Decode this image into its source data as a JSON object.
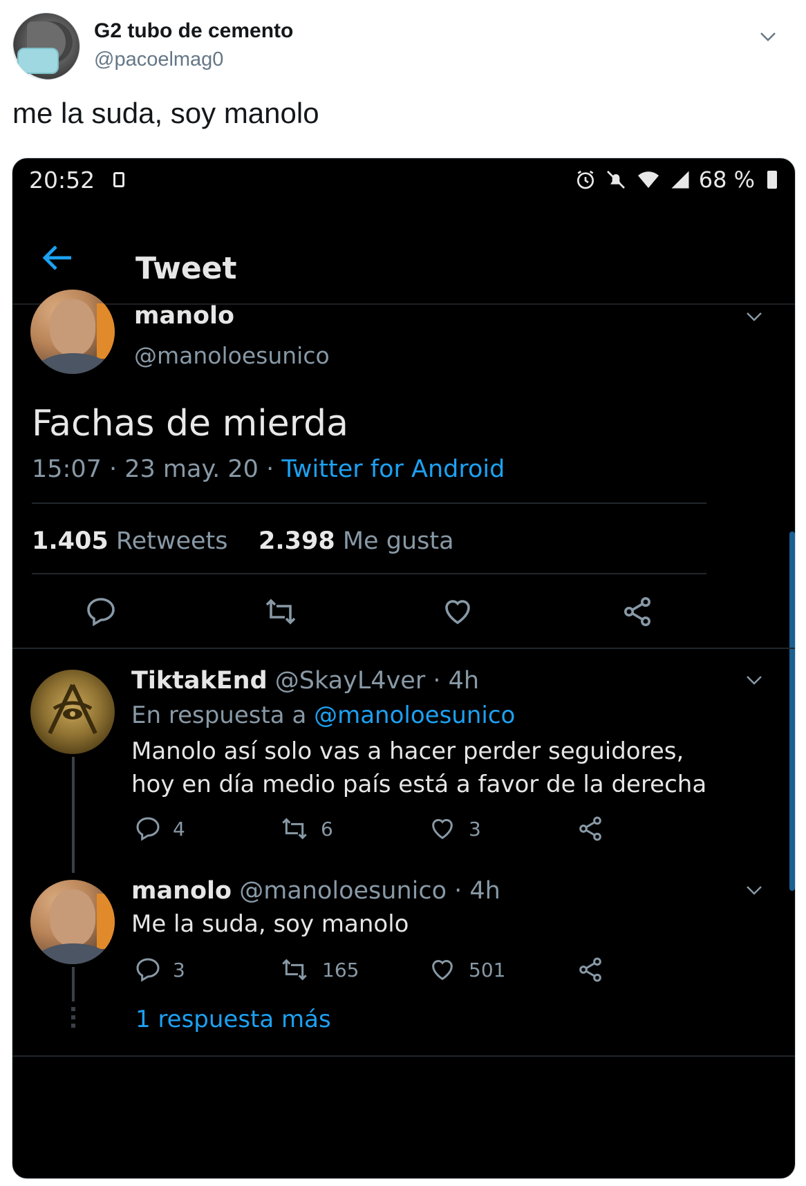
{
  "outer": {
    "name": "G2 tubo de cemento",
    "handle": "@pacoelmag0",
    "text": "me la suda, soy manolo"
  },
  "status_bar": {
    "time": "20:52",
    "battery": "68 %"
  },
  "topbar": {
    "title": "Tweet"
  },
  "main_tweet": {
    "name": "manolo",
    "handle": "@manoloesunico",
    "text": "Fachas de mierda",
    "time": "15:07 · 23 may. 20 · ",
    "source": "Twitter for Android",
    "retweets_count": "1.405",
    "retweets_label": " Retweets",
    "likes_count": "2.398",
    "likes_label": " Me gusta"
  },
  "replies": [
    {
      "name": "TiktakEnd",
      "meta": " @SkayL4ver · 4h",
      "reply_to_label": "En respuesta a ",
      "reply_to_mention": "@manoloesunico",
      "text": "Manolo así solo vas a hacer perder seguidores, hoy en día medio país está a favor de la derecha",
      "replies": "4",
      "retweets": "6",
      "likes": "3"
    },
    {
      "name": "manolo",
      "meta": " @manoloesunico · 4h",
      "text": "Me la suda, soy manolo",
      "replies": "3",
      "retweets": "165",
      "likes": "501"
    }
  ],
  "more_replies": "1 respuesta más",
  "icons": {
    "outer_menu": "chevron-down-icon",
    "back": "arrow-left-icon",
    "reply": "comment-icon",
    "retweet": "retweet-icon",
    "like": "heart-icon",
    "share": "share-icon"
  },
  "colors": {
    "accent": "#1da1f2",
    "dark_bg": "#000000",
    "muted": "#8899a6"
  }
}
